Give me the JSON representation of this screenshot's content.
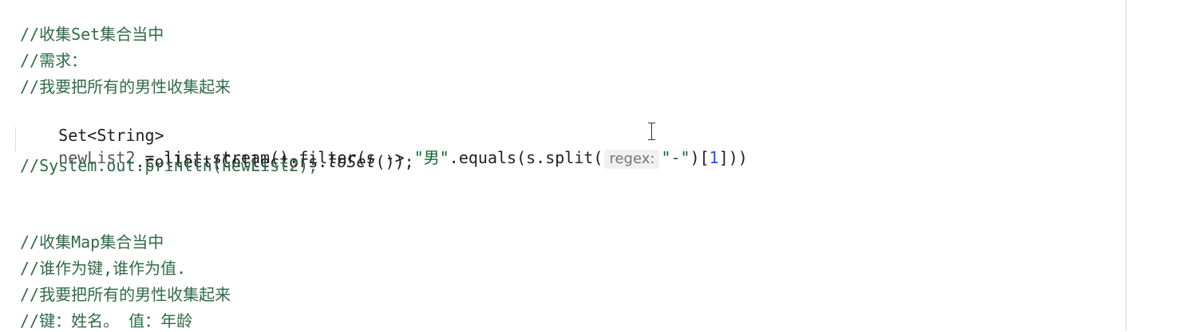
{
  "editor": {
    "lines": [
      {
        "comment": "//收集Set集合当中"
      },
      {
        "comment": "//需求："
      },
      {
        "comment": "//我要把所有的男性收集起来"
      },
      {
        "type_name": "Set<String>",
        "var_name": "newList2",
        "eq": " = ",
        "stream": "list.stream().filter(s -> ",
        "string_male": "\"男\"",
        "equals": ".equals(s.split(",
        "hint": "regex:",
        "string_dash": "\"-\"",
        "bracket_open": ")[",
        "index": "1",
        "bracket_close": "]))"
      },
      {
        "collect_prefix": "        .collect(Collectors.",
        "method": "toSet",
        "collect_suffix": "());"
      },
      {
        "comment": "//System.out.println(newList2);"
      },
      {
        "comment": "//收集Map集合当中"
      },
      {
        "comment": "//谁作为键,谁作为值."
      },
      {
        "comment": "//我要把所有的男性收集起来"
      },
      {
        "comment": "//键：姓名。 值：年龄"
      }
    ]
  }
}
